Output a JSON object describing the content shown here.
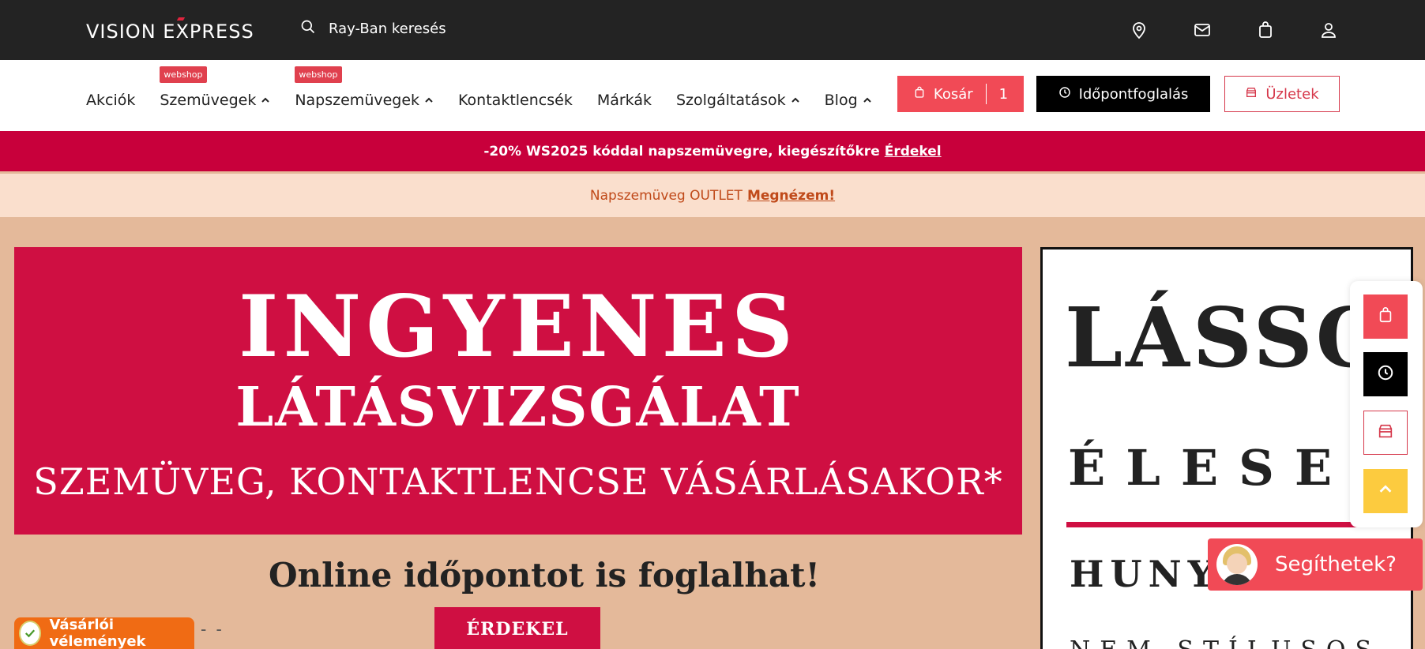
{
  "header": {
    "logo_left": "VISION E",
    "logo_x": "X",
    "logo_right": "PRESS",
    "search_text": "Ray-Ban keresés",
    "icons": [
      "location-pin-icon",
      "mail-icon",
      "bag-icon",
      "user-icon"
    ]
  },
  "nav": {
    "items": [
      {
        "label": "Akciók",
        "badge": "",
        "chevron": false
      },
      {
        "label": "Szemüvegek",
        "badge": "webshop",
        "chevron": true
      },
      {
        "label": "Napszemüvegek",
        "badge": "webshop",
        "chevron": true
      },
      {
        "label": "Kontaktlencsék",
        "badge": "",
        "chevron": false
      },
      {
        "label": "Márkák",
        "badge": "",
        "chevron": false
      },
      {
        "label": "Szolgáltatások",
        "badge": "",
        "chevron": true
      },
      {
        "label": "Blog",
        "badge": "",
        "chevron": true
      }
    ],
    "cart_label": "Kosár",
    "cart_count": "1",
    "appointment_label": "Időpontfoglalás",
    "stores_label": "Üzletek"
  },
  "promo": {
    "line1_text": "-20% WS2025 kóddal napszemüvegre, kiegészítőkre",
    "line1_link": "Érdekel",
    "line2_text": "Napszemüveg OUTLET",
    "line2_link": "Megnézem!"
  },
  "hero": {
    "title": "INGYENES",
    "subtitle": "LÁTÁSVIZSGÁLAT",
    "tagline": "SZEMÜVEG, KONTAKTLENCSE VÁSÁRLÁSAKOR*",
    "online": "Online időpontot is foglalhat!",
    "button": "ÉRDEKEL",
    "dots": "- -"
  },
  "eye_chart": {
    "line1": "LÁSSON",
    "line2": "ÉLESEN",
    "line3": "HUNYO",
    "line4": "NEM STÍLUSOS"
  },
  "floating": {
    "buttons": [
      "bag-icon",
      "clock-icon",
      "store-icon",
      "chevron-up-icon"
    ]
  },
  "chat": {
    "label": "Segíthetek?"
  },
  "reviews": {
    "label": "Vásárlói vélemények"
  },
  "colors": {
    "brand_red": "#cf0f42",
    "accent_red": "#f14a56",
    "topbar": "#232323",
    "promo_peach": "#fadfcd",
    "hero_bg": "#e4b99a",
    "yellow": "#fccb3f",
    "orange": "#f06b14"
  }
}
